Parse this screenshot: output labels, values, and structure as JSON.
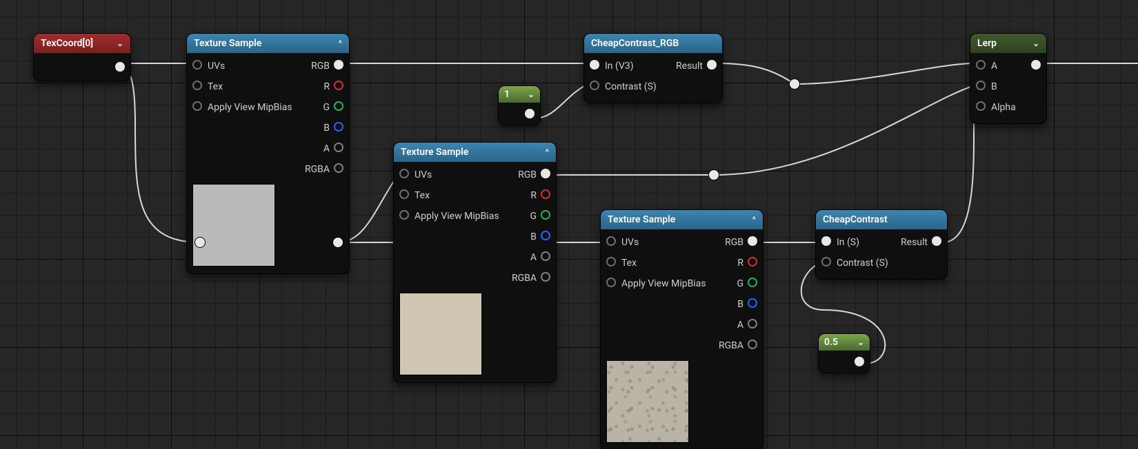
{
  "nodes": {
    "texcoord": {
      "title": "TexCoord[0]",
      "chevron": "⌄"
    },
    "texSample1": {
      "title": "Texture Sample",
      "inputs": [
        "UVs",
        "Tex",
        "Apply View MipBias"
      ],
      "outputs": [
        "RGB",
        "R",
        "G",
        "B",
        "A",
        "RGBA"
      ],
      "preview_color": "#bababa",
      "chev": "^"
    },
    "texSample2": {
      "title": "Texture Sample",
      "inputs": [
        "UVs",
        "Tex",
        "Apply View MipBias"
      ],
      "outputs": [
        "RGB",
        "R",
        "G",
        "B",
        "A",
        "RGBA"
      ],
      "preview_color": "#cfc7b2",
      "chev": "^"
    },
    "texSample3": {
      "title": "Texture Sample",
      "inputs": [
        "UVs",
        "Tex",
        "Apply View MipBias"
      ],
      "outputs": [
        "RGB",
        "R",
        "G",
        "B",
        "A",
        "RGBA"
      ],
      "preview": "noise",
      "chev": "^"
    },
    "const1": {
      "value": "1",
      "chev": "⌄"
    },
    "const05": {
      "value": "0.5",
      "chev": "⌄"
    },
    "cheapRGB": {
      "title": "CheapContrast_RGB",
      "inputs": [
        "In (V3)",
        "Contrast (S)"
      ],
      "outputs": [
        "Result"
      ]
    },
    "cheap": {
      "title": "CheapContrast",
      "inputs": [
        "In (S)",
        "Contrast (S)"
      ],
      "outputs": [
        "Result"
      ]
    },
    "lerp": {
      "title": "Lerp",
      "inputs": [
        "A",
        "B",
        "Alpha"
      ],
      "outputs": [
        ""
      ],
      "chev": "⌄"
    }
  }
}
